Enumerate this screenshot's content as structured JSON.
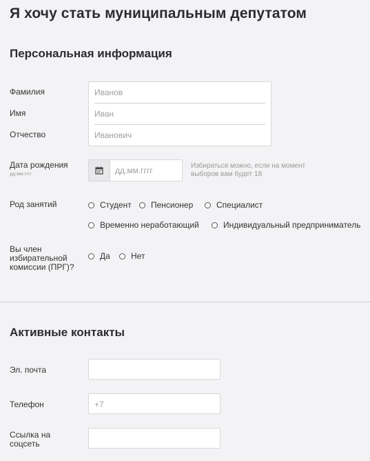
{
  "page": {
    "title": "Я хочу стать муниципальным депутатом"
  },
  "personal": {
    "section_title": "Персональная информация",
    "last_name": {
      "label": "Фамилия",
      "placeholder": "Иванов"
    },
    "first_name": {
      "label": "Имя",
      "placeholder": "Иван"
    },
    "middle_name": {
      "label": "Отчество",
      "placeholder": "Иванович"
    },
    "birth_date": {
      "label": "Дата рождения",
      "format_hint": "дд.мм.гггг",
      "placeholder": "дд.мм.гггг",
      "note": "Избираться можно, если на момент выборов вам будет 18",
      "icon": "calendar-icon"
    },
    "occupation": {
      "label": "Род занятий",
      "options": [
        "Студент",
        "Пенсионер",
        "Специалист",
        "Временно неработающий",
        "Индивидуальный предприниматель"
      ]
    },
    "commission": {
      "label": "Вы член избирательной комиссии (ПРГ)?",
      "options": [
        "Да",
        "Нет"
      ]
    }
  },
  "contacts": {
    "section_title": "Активные контакты",
    "email": {
      "label": "Эл. почта",
      "value": ""
    },
    "phone": {
      "label": "Телефон",
      "placeholder": "+7"
    },
    "social": {
      "label": "Ссылка на соцсеть",
      "value": ""
    }
  },
  "colors": {
    "background": "#f3f2f4",
    "input_bg": "#ffffff",
    "border": "#d8d8da"
  }
}
